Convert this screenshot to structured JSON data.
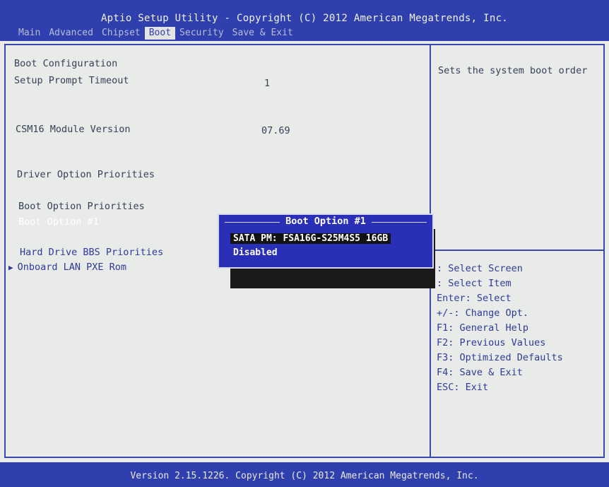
{
  "header": {
    "title": "Aptio Setup Utility - Copyright (C) 2012 American Megatrends, Inc.",
    "tabs": [
      "Main",
      "Advanced",
      "Chipset",
      "Boot",
      "Security",
      "Save & Exit"
    ],
    "active_tab": "Boot"
  },
  "left": {
    "boot_configuration": "Boot Configuration",
    "setup_prompt_timeout_label": "Setup Prompt Timeout",
    "setup_prompt_timeout_value": "1",
    "csm16_label": "CSM16 Module Version",
    "csm16_value": "07.69",
    "driver_option_priorities": "Driver Option Priorities",
    "boot_option_priorities": "Boot Option Priorities",
    "boot_option_1": "Boot Option #1",
    "hard_drive_bbs": "Hard Drive BBS Priorities",
    "onboard_lan": "Onboard LAN PXE Rom"
  },
  "right": {
    "help_text": "Sets the system boot order",
    "legend": [
      ": Select Screen",
      ": Select Item",
      "Enter: Select",
      "+/-: Change Opt.",
      "F1: General Help",
      "F2: Previous Values",
      "F3: Optimized Defaults",
      "F4: Save & Exit",
      "ESC: Exit"
    ]
  },
  "popup": {
    "title": "Boot Option #1",
    "options": [
      "SATA  PM: FSA16G-S25M4S5 16GB",
      "Disabled"
    ],
    "selected": "SATA  PM: FSA16G-S25M4S5 16GB"
  },
  "footer": {
    "text": "Version 2.15.1226. Copyright (C) 2012 American Megatrends, Inc."
  },
  "colors": {
    "bar_blue": "#2f3fae",
    "popup_blue": "#2a2fb8",
    "background": "#e9ebe8"
  }
}
